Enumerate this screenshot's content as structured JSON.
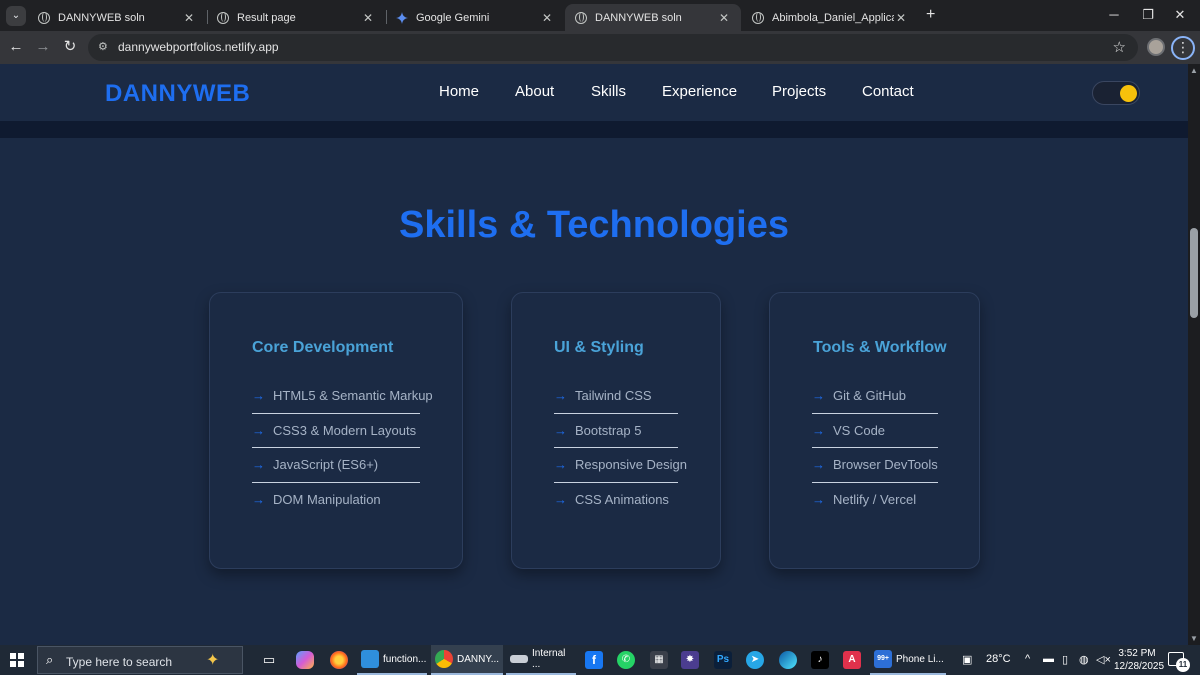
{
  "browser": {
    "tabs": [
      {
        "title": "DANNYWEB soln",
        "active": false
      },
      {
        "title": "Result page",
        "active": false
      },
      {
        "title": "Google Gemini",
        "active": false
      },
      {
        "title": "DANNYWEB soln",
        "active": true
      },
      {
        "title": "Abimbola_Daniel_Application.p",
        "active": false
      }
    ],
    "close_glyph": "✕",
    "new_tab_glyph": "+",
    "url": "dannywebportfolios.netlify.app"
  },
  "site": {
    "brand": "DANNYWEB",
    "nav": [
      "Home",
      "About",
      "Skills",
      "Experience",
      "Projects",
      "Contact"
    ],
    "theme_toggle_on": true,
    "accent_color": "#1e6ef0",
    "card_title_color": "#4aa3d8",
    "toggle_color": "#f7c10b"
  },
  "skills": {
    "title": "Skills & Technologies",
    "arrow": "→",
    "cards": [
      {
        "title": "Core Development",
        "items": [
          "HTML5 & Semantic Markup",
          "CSS3 & Modern Layouts",
          "JavaScript (ES6+)",
          "DOM Manipulation"
        ]
      },
      {
        "title": "UI & Styling",
        "items": [
          "Tailwind CSS",
          "Bootstrap 5",
          "Responsive Design",
          "CSS Animations"
        ]
      },
      {
        "title": "Tools & Workflow",
        "items": [
          "Git & GitHub",
          "VS Code",
          "Browser DevTools",
          "Netlify / Vercel"
        ]
      }
    ]
  },
  "taskbar": {
    "search_placeholder": "Type here to search",
    "apps": [
      {
        "label": "function..."
      },
      {
        "label": "DANNY..."
      },
      {
        "label": "Internal ..."
      },
      {
        "label": "Phone Li..."
      }
    ],
    "photoshop_label": "Ps",
    "phone_badge": "99+",
    "temperature": "28°C",
    "time": "3:52 PM",
    "date": "12/28/2025",
    "notifications": "11"
  }
}
